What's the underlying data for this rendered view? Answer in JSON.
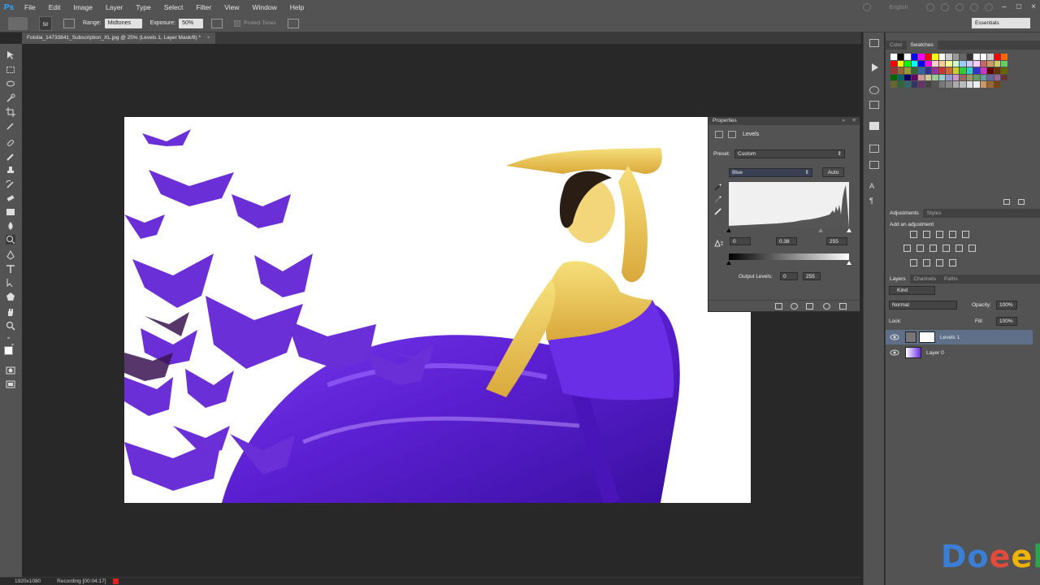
{
  "app": {
    "logo": "Ps"
  },
  "menu": [
    "File",
    "Edit",
    "Image",
    "Layer",
    "Type",
    "Select",
    "Filter",
    "View",
    "Window",
    "Help"
  ],
  "system": {
    "language": "English"
  },
  "options": {
    "brush_size": "50",
    "range_label": "Range:",
    "range_value": "Midtones",
    "exposure_label": "Exposure:",
    "exposure_value": "50%",
    "protect_tones": "Protect Tones",
    "workspace": "Essentials"
  },
  "document": {
    "tab_title": "Fotolia_14733841_Subscription_XL.jpg @ 25% (Levels 1, Layer Mask/8) *",
    "close": "×"
  },
  "properties": {
    "panel_title": "Properties",
    "adjustment": "Levels",
    "preset_label": "Preset:",
    "preset_value": "Custom",
    "channel": "Blue",
    "auto_label": "Auto",
    "input_black": "0",
    "input_gamma": "0.38",
    "input_white": "255",
    "output_label": "Output Levels:",
    "output_black": "0",
    "output_white": "255"
  },
  "right_panels": {
    "color_tab": "Color",
    "swatches_tab": "Swatches",
    "adjustments_tab": "Adjustments",
    "styles_tab": "Styles",
    "add_adjustment": "Add an adjustment",
    "layers_tab": "Layers",
    "channels_tab": "Channels",
    "paths_tab": "Paths",
    "kind_filter": "Kind",
    "blend_mode": "Normal",
    "opacity_label": "Opacity:",
    "opacity_value": "100%",
    "lock_label": "Lock:",
    "fill_label": "Fill:",
    "fill_value": "100%",
    "layers": [
      {
        "name": "Levels 1",
        "selected": true
      },
      {
        "name": "Layer 0",
        "selected": false
      }
    ]
  },
  "status": {
    "resolution": "1920x1080",
    "recording": "Recording [00:04:17]"
  },
  "watermark": {
    "letters": [
      "D",
      "o",
      "e",
      "e",
      "l"
    ],
    "colors": [
      "#3a7fd5",
      "#3a7fd5",
      "#e04b3c",
      "#f0b400",
      "#2ea44f"
    ]
  },
  "colors": {
    "chrome": "#535353",
    "workspace": "#282828",
    "selection": "#5f6f87",
    "accent_purple": "#5a1fd0"
  }
}
